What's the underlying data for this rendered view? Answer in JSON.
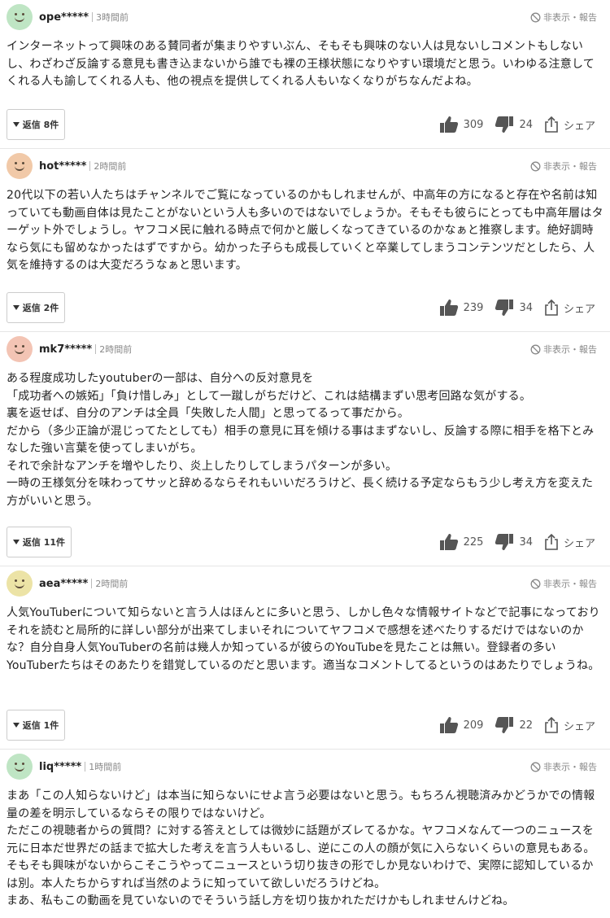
{
  "comments": [
    {
      "user": "ope*****",
      "time": "3時間前",
      "report": "非表示・報告",
      "avatar_color": "#bfe5c4",
      "text": "インターネットって興味のある賛同者が集まりやすいぶん、そもそも興味のない人は見ないしコメントもしないし、わざわざ反論する意見も書き込まないから誰でも裸の王様状態になりやすい環境だと思う。いわゆる注意してくれる人も諭してくれる人も、他の視点を提供してくれる人もいなくなりがちなんだよね。",
      "replies": "返信 8件",
      "likes": "309",
      "dislikes": "24",
      "share": "シェア"
    },
    {
      "user": "hot*****",
      "time": "2時間前",
      "report": "非表示・報告",
      "avatar_color": "#f1c9a8",
      "text": "20代以下の若い人たちはチャンネルでご覧になっているのかもしれませんが、中高年の方になると存在や名前は知っていても動画自体は見たことがないという人も多いのではないでしょうか。そもそも彼らにとっても中高年層はターゲット外でしょうし。ヤフコメ民に触れる時点で何かと厳しくなってきているのかなぁと推察します。絶好調時なら気にも留めなかったはずですから。幼かった子らも成長していくと卒業してしまうコンテンツだとしたら、人気を維持するのは大変だろうなぁと思います。",
      "replies": "返信 2件",
      "likes": "239",
      "dislikes": "34",
      "share": "シェア"
    },
    {
      "user": "mk7*****",
      "time": "2時間前",
      "report": "非表示・報告",
      "avatar_color": "#f3c4b4",
      "text": "ある程度成功したyoutuberの一部は、自分への反対意見を\n「成功者への嫉妬」「負け惜しみ」として一蹴しがちだけど、これは結構まずい思考回路な気がする。\n裏を返せば、自分のアンチは全員「失敗した人間」と思ってるって事だから。\nだから（多少正論が混じってたとしても）相手の意見に耳を傾ける事はまずないし、反論する際に相手を格下とみなした強い言葉を使ってしまいがち。\nそれで余計なアンチを増やしたり、炎上したりしてしまうパターンが多い。\n一時の王様気分を味わってサッと辞めるならそれもいいだろうけど、長く続ける予定ならもう少し考え方を変えた方がいいと思う。",
      "replies": "返信 11件",
      "likes": "225",
      "dislikes": "34",
      "share": "シェア"
    },
    {
      "user": "aea*****",
      "time": "2時間前",
      "report": "非表示・報告",
      "avatar_color": "#ece3a6",
      "text": "人気YouTuberについて知らないと言う人はほんとに多いと思う、しかし色々な情報サイトなどで記事になっておりそれを読むと局所的に詳しい部分が出来てしまいそれについてヤフコメで感想を述べたりするだけではないのかな？自分自身人気YouTuberの名前は幾人か知っているが彼らのYouTubeを見たことは無い。登録者の多いYouTuberたちはそのあたりを錯覚しているのだと思います。適当なコメントしてるというのはあたりでしょうね。",
      "replies": "返信 1件",
      "likes": "209",
      "dislikes": "22",
      "share": "シェア"
    },
    {
      "user": "liq*****",
      "time": "1時間前",
      "report": "非表示・報告",
      "avatar_color": "#bfe5c4",
      "text": "まあ「この人知らないけど」は本当に知らないにせよ言う必要はないと思う。もちろん視聴済みかどうかでの情報量の差を明示しているならその限りではないけど。\nただこの視聴者からの質問？に対する答えとしては微妙に話題がズレてるかな。ヤフコメなんて一つのニュースを元に日本だ世界だの話まで拡大した考えを言う人もいるし、逆にこの人の顔が気に入らないくらいの意見もある。そもそも興味がないからこそこうやってニュースという切り抜きの形でしか見ないわけで、実際に認知しているかは別。本人たちからすれば当然のように知っていて欲しいだろうけどね。\nまあ、私もこの動画を見ていないのでそういう話し方を切り抜かれただけかもしれませんけどね。",
      "replies": "",
      "likes": "",
      "dislikes": "",
      "share": ""
    }
  ]
}
